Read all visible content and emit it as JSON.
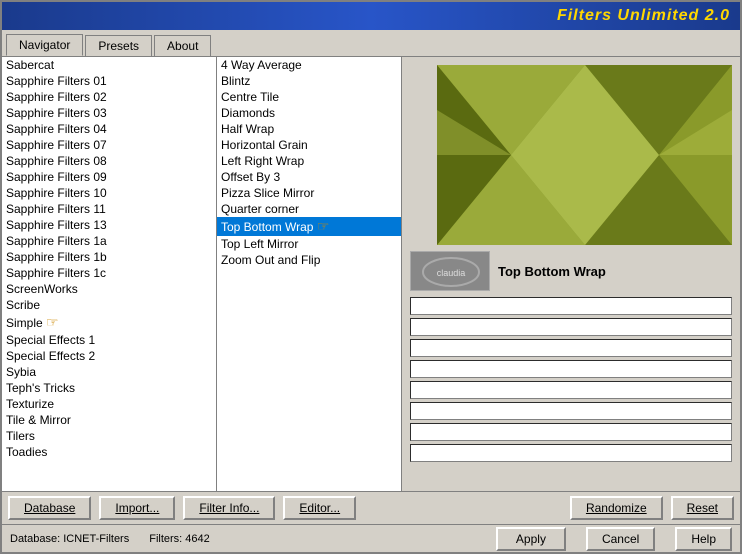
{
  "titleBar": {
    "text": "Filters Unlimited 2.0"
  },
  "tabs": [
    {
      "label": "Navigator",
      "active": true
    },
    {
      "label": "Presets",
      "active": false
    },
    {
      "label": "About",
      "active": false
    }
  ],
  "leftList": {
    "items": [
      "Sabercat",
      "Sapphire Filters 01",
      "Sapphire Filters 02",
      "Sapphire Filters 03",
      "Sapphire Filters 04",
      "Sapphire Filters 07",
      "Sapphire Filters 08",
      "Sapphire Filters 09",
      "Sapphire Filters 10",
      "Sapphire Filters 11",
      "Sapphire Filters 13",
      "Sapphire Filters 1a",
      "Sapphire Filters 1b",
      "Sapphire Filters 1c",
      "ScreenWorks",
      "Scribe",
      "Simple",
      "Special Effects 1",
      "Special Effects 2",
      "Sybia",
      "Teph's Tricks",
      "Texturize",
      "Tile & Mirror",
      "Tilers",
      "Toadies"
    ],
    "selectedIndex": -1
  },
  "rightList": {
    "items": [
      "4 Way Average",
      "Blintz",
      "Centre Tile",
      "Diamonds",
      "Half Wrap",
      "Horizontal Grain",
      "Left Right Wrap",
      "Offset By 3",
      "Pizza Slice Mirror",
      "Quarter corner",
      "Top Bottom Wrap",
      "Top Left Mirror",
      "Zoom Out and Flip"
    ],
    "selectedItem": "Top Bottom Wrap"
  },
  "filterName": "Top Bottom Wrap",
  "status": {
    "database": "ICNET-Filters",
    "filters": "4642",
    "databaseLabel": "Database:",
    "filtersLabel": "Filters:"
  },
  "bottomButtons": {
    "database": "Database",
    "import": "Import...",
    "filterInfo": "Filter Info...",
    "editor": "Editor...",
    "randomize": "Randomize",
    "reset": "Reset"
  },
  "statusButtons": {
    "apply": "Apply",
    "cancel": "Cancel",
    "help": "Help"
  }
}
